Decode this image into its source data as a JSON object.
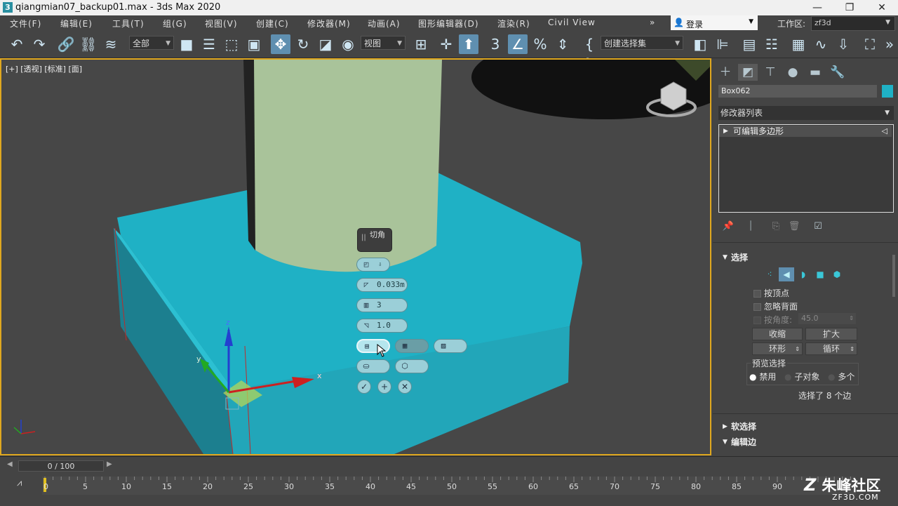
{
  "titlebar": {
    "app_icon": "3",
    "title": "qiangmian07_backup01.max - 3ds Max 2020",
    "minimize": "—",
    "restore": "❐",
    "close": "✕"
  },
  "menu": [
    "文件(F)",
    "编辑(E)",
    "工具(T)",
    "组(G)",
    "视图(V)",
    "创建(C)",
    "修改器(M)",
    "动画(A)",
    "图形编辑器(D)",
    "渲染(R)",
    "Civil View"
  ],
  "menu_more": "»",
  "login": "登录",
  "workspace": {
    "label": "工作区:",
    "value": "zf3d"
  },
  "toolbar": {
    "filter": "全部",
    "coord": "视图",
    "selection_set": "创建选择集"
  },
  "viewport": {
    "label": "[+] [透视] [标准] [面]",
    "caddy": {
      "title": "切角",
      "amount": "0.033m",
      "segments": "3",
      "tension": "1.0"
    }
  },
  "command_panel": {
    "object_name": "Box062",
    "modifier_list": "修改器列表",
    "stack_item": "可编辑多边形",
    "selection": {
      "title": "选择",
      "by_vertex": "按顶点",
      "ignore_backfacing": "忽略背面",
      "by_angle": "按角度:",
      "angle_value": "45.0",
      "shrink": "收缩",
      "grow": "扩大",
      "ring": "环形",
      "loop": "循环",
      "preview_title": "预览选择",
      "preview_off": "禁用",
      "preview_sub": "子对象",
      "preview_multi": "多个",
      "status": "选择了 8 个边"
    },
    "soft_selection": "软选择",
    "edit_edges": "编辑边"
  },
  "timeline": {
    "slider": "0 / 100",
    "ticks": [
      "0",
      "5",
      "10",
      "15",
      "20",
      "25",
      "30",
      "35",
      "40",
      "45",
      "50",
      "55",
      "60",
      "65",
      "70",
      "75",
      "80",
      "85",
      "90"
    ]
  },
  "watermark": {
    "main": "朱峰社区",
    "sub": "ZF3D.COM"
  },
  "colors": {
    "object": "#1fb1c5",
    "cylinder": "#a9c39a",
    "viewport_border": "#e0a81f",
    "active_tool": "#5f8fb0"
  }
}
